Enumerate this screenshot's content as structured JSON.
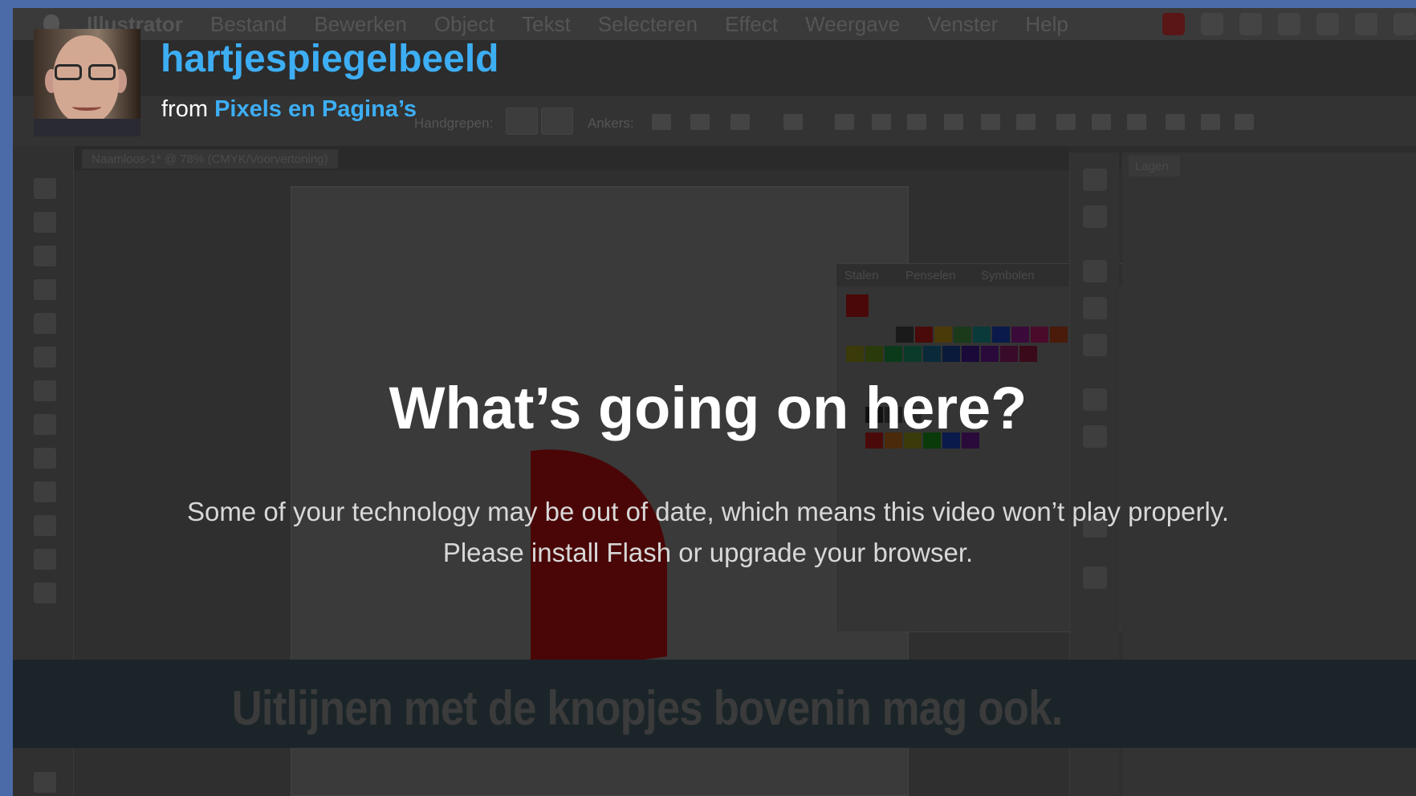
{
  "menubar": {
    "items": [
      "Illustrator",
      "Bestand",
      "Bewerken",
      "Object",
      "Tekst",
      "Selecteren",
      "Effect",
      "Weergave",
      "Venster",
      "Help"
    ]
  },
  "toolbar": {
    "handgrepen_label": "Handgrepen:",
    "ankers_label": "Ankers:"
  },
  "document": {
    "tab_label": "Naamloos-1* @ 78% (CMYK/Voorvertoning)"
  },
  "swatches_panel": {
    "tabs": [
      "Stalen",
      "Penselen",
      "Symbolen"
    ]
  },
  "layers_panel": {
    "tab": "Lagen"
  },
  "video": {
    "caption": "Uitlijnen met de knopjes bovenin mag ook.",
    "title": "hartjespiegelbeeld",
    "byline_prefix": "from",
    "channel": "Pixels en Pagina’s"
  },
  "message": {
    "heading": "What’s going on here?",
    "body": "Some of your technology may be out of date, which means this video won’t play properly. Please install Flash or upgrade your browser."
  },
  "colors": {
    "link_blue": "#3daef4",
    "border_blue": "#4a6aa8",
    "heart_red": "#4a0606"
  }
}
